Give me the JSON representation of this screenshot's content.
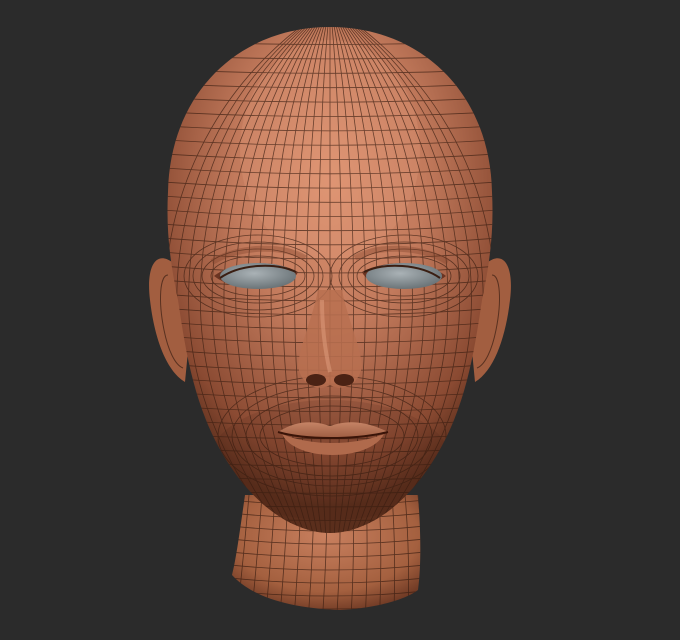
{
  "viewport": {
    "background": "#2b2b2b",
    "model": {
      "subject": "head-mesh",
      "material_color": "#c27a5c",
      "shadow_color": "#5a2e1c",
      "wire_color": "#3a1e12",
      "eye_color": "#8e979b",
      "show_wireframe": true
    }
  }
}
